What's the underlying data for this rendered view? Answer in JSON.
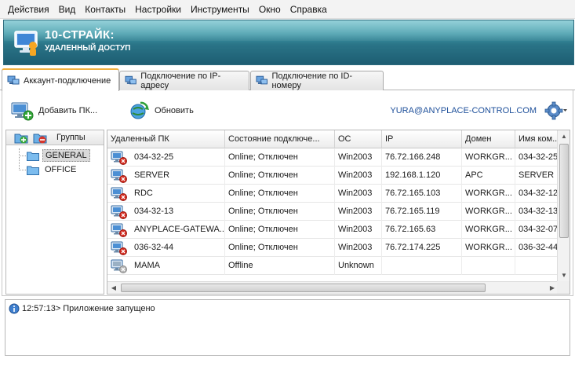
{
  "menu": [
    "Действия",
    "Вид",
    "Контакты",
    "Настройки",
    "Инструменты",
    "Окно",
    "Справка"
  ],
  "banner": {
    "title": "10-СТРАЙК:",
    "subtitle": "УДАЛЕННЫЙ ДОСТУП"
  },
  "tabs": [
    {
      "label": "Аккаунт-подключение",
      "active": true
    },
    {
      "label": "Подключение по IP-адресу",
      "active": false
    },
    {
      "label": "Подключение по ID-номеру",
      "active": false
    }
  ],
  "toolbar": {
    "add_label": "Добавить ПК...",
    "refresh_label": "Обновить",
    "account": "YURA@ANYPLACE-CONTROL.COM"
  },
  "groups": {
    "header": "Группы",
    "items": [
      {
        "label": "GENERAL",
        "selected": true
      },
      {
        "label": "OFFICE",
        "selected": false
      }
    ]
  },
  "table": {
    "columns": [
      "Удаленный ПК",
      "Состояние подключе...",
      "ОС",
      "IP",
      "Домен",
      "Имя ком..."
    ],
    "rows": [
      {
        "pc": "034-32-25",
        "state": "Online; Отключен",
        "os": "Win2003",
        "ip": "76.72.166.248",
        "domain": "WORKGR...",
        "name": "034-32-25",
        "status_icon": "disconnected-icon"
      },
      {
        "pc": "SERVER",
        "state": "Online; Отключен",
        "os": "Win2003",
        "ip": "192.168.1.120",
        "domain": "APC",
        "name": "SERVER",
        "status_icon": "disconnected-icon"
      },
      {
        "pc": "RDC",
        "state": "Online; Отключен",
        "os": "Win2003",
        "ip": "76.72.165.103",
        "domain": "WORKGR...",
        "name": "034-32-12",
        "status_icon": "disconnected-icon"
      },
      {
        "pc": "034-32-13",
        "state": "Online; Отключен",
        "os": "Win2003",
        "ip": "76.72.165.119",
        "domain": "WORKGR...",
        "name": "034-32-13",
        "status_icon": "disconnected-icon"
      },
      {
        "pc": "ANYPLACE-GATEWA...",
        "state": "Online; Отключен",
        "os": "Win2003",
        "ip": "76.72.165.63",
        "domain": "WORKGR...",
        "name": "034-32-07",
        "status_icon": "disconnected-icon"
      },
      {
        "pc": "036-32-44",
        "state": "Online; Отключен",
        "os": "Win2003",
        "ip": "76.72.174.225",
        "domain": "WORKGR...",
        "name": "036-32-44",
        "status_icon": "disconnected-icon"
      },
      {
        "pc": "MAMA",
        "state": "Offline",
        "os": "Unknown",
        "ip": "",
        "domain": "",
        "name": "",
        "status_icon": "offline-icon"
      }
    ]
  },
  "log": {
    "time": "12:57:13>",
    "message": "Приложение запущено"
  },
  "colors": {
    "banner": "#2a7487",
    "accent_tab": "#f0b040",
    "account_link": "#1d4f9a",
    "error_badge": "#d42a1e"
  }
}
